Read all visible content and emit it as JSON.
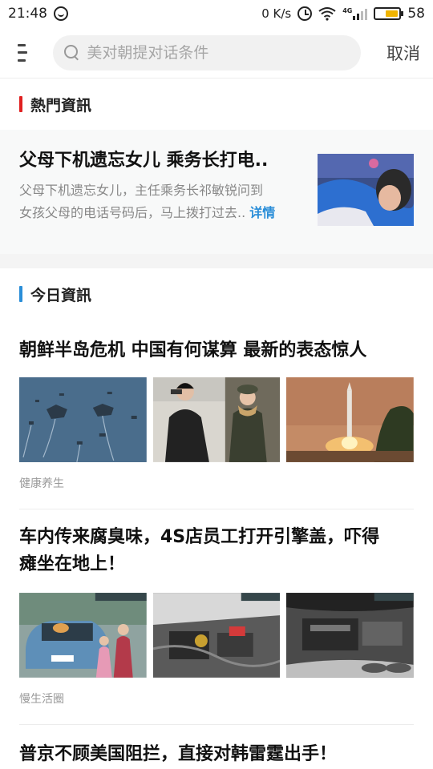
{
  "status_bar": {
    "time": "21:48",
    "net_speed": "0 K/s",
    "network_type": "4G",
    "battery": "58",
    "battery_level": 0.58
  },
  "search": {
    "placeholder": "美对朝提对话条件",
    "cancel_label": "取消"
  },
  "hot_section": {
    "title": "熱門資訊",
    "accent": "#e02020",
    "card": {
      "title": "父母下机遗忘女儿 乘务长打电..",
      "desc_line1": "父母下机遗忘女儿，主任乘务长祁敏锐问到",
      "desc_line2": "女孩父母的电话号码后，马上拨打过去..",
      "more_label": "详情"
    }
  },
  "today_section": {
    "title": "今日資訊",
    "accent": "#2a8ed8",
    "articles": [
      {
        "title": "朝鲜半岛危机 中国有何谋算 最新的表态惊人",
        "source": "健康养生"
      },
      {
        "title_line1": "车内传来腐臭味，4S店员工打开引擎盖，吓得",
        "title_line2": "瘫坐在地上！",
        "source": "慢生活圈"
      },
      {
        "title": "普京不顾美国阻拦，直接对韩雷霆出手！"
      }
    ]
  }
}
